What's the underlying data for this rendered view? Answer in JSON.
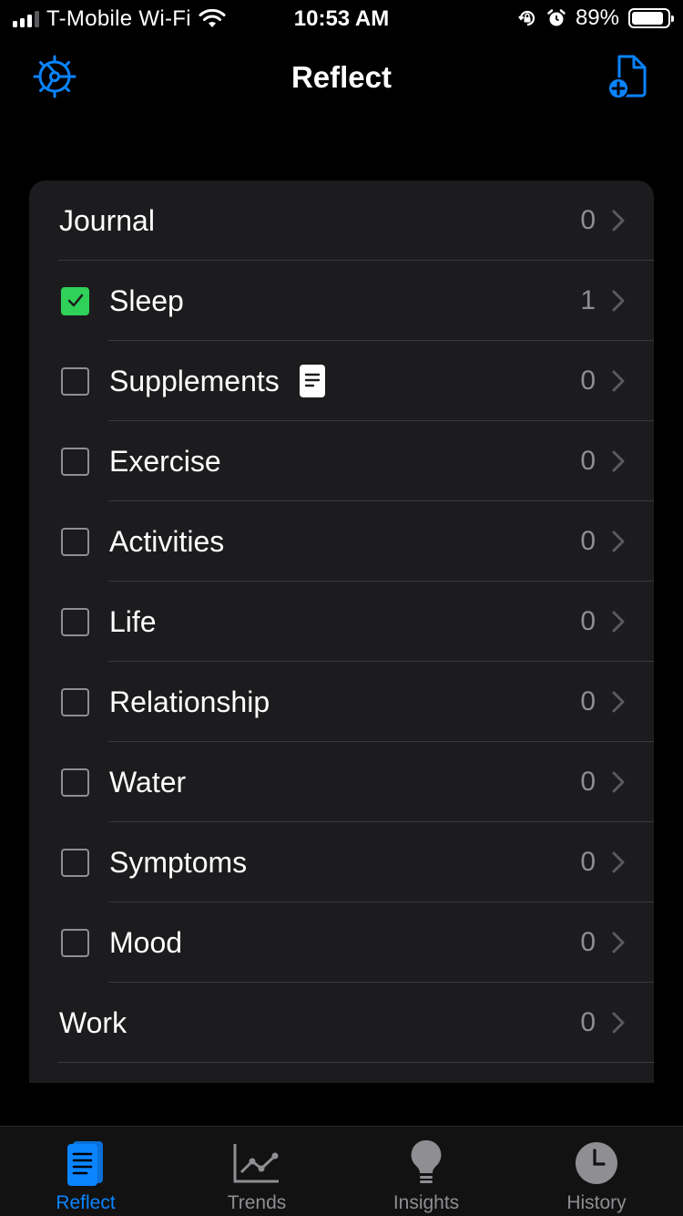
{
  "status_bar": {
    "carrier": "T-Mobile Wi-Fi",
    "time": "10:53 AM",
    "battery_percent": "89%",
    "battery_level": 0.89,
    "icons": [
      "signal-icon",
      "wifi-icon",
      "orientation-lock-icon",
      "alarm-icon",
      "battery-icon"
    ]
  },
  "nav": {
    "title": "Reflect",
    "left_icon": "settings-gear-icon",
    "right_icon": "new-document-icon"
  },
  "list": {
    "rows": [
      {
        "label": "Journal",
        "count": "0",
        "type": "plain"
      },
      {
        "label": "Sleep",
        "count": "1",
        "type": "check",
        "checked": true
      },
      {
        "label": "Supplements",
        "count": "0",
        "type": "check",
        "checked": false,
        "has_note": true
      },
      {
        "label": "Exercise",
        "count": "0",
        "type": "check",
        "checked": false
      },
      {
        "label": "Activities",
        "count": "0",
        "type": "check",
        "checked": false
      },
      {
        "label": "Life",
        "count": "0",
        "type": "check",
        "checked": false
      },
      {
        "label": "Relationship",
        "count": "0",
        "type": "check",
        "checked": false
      },
      {
        "label": "Water",
        "count": "0",
        "type": "check",
        "checked": false
      },
      {
        "label": "Symptoms",
        "count": "0",
        "type": "check",
        "checked": false
      },
      {
        "label": "Mood",
        "count": "0",
        "type": "check",
        "checked": false
      },
      {
        "label": "Work",
        "count": "0",
        "type": "plain"
      }
    ]
  },
  "tabs": [
    {
      "label": "Reflect",
      "icon": "journal-icon",
      "active": true
    },
    {
      "label": "Trends",
      "icon": "line-chart-icon",
      "active": false
    },
    {
      "label": "Insights",
      "icon": "lightbulb-icon",
      "active": false
    },
    {
      "label": "History",
      "icon": "clock-icon",
      "active": false
    }
  ],
  "colors": {
    "accent": "#0a84ff",
    "checked": "#30d158",
    "background": "#000000",
    "card": "#1c1c1e",
    "secondary_text": "#8e8e93"
  }
}
